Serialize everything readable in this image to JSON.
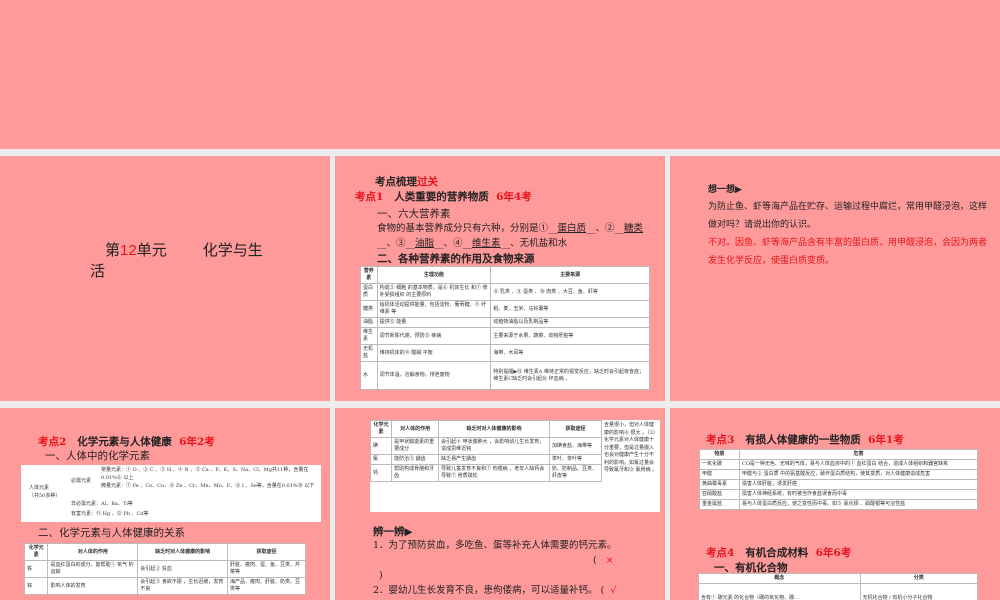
{
  "slide1": {
    "prefix": "第",
    "num": "12",
    "unit": "单元",
    "title1": "化学与生",
    "title2": "活"
  },
  "slide2": {
    "header_a": "考点梳理",
    "header_b": "过关",
    "point_label": "考点1",
    "point_title": "人类重要的营养物质",
    "point_freq": "6年4考",
    "sec1": "一、六大营养素",
    "para_a": "食物的基本营养成分只有六种，分别是①",
    "a1": "蛋白质",
    "a2": "糖类",
    "a3": "油脂",
    "a4": "维生素",
    "para_end": "、无机盐和水",
    "sec2": "二、各种营养素的作用及食物来源",
    "table": {
      "headers": [
        "营养素",
        "生理功能",
        "主要来源"
      ],
      "rows": [
        [
          "蛋白质",
          "构成⑤ 细胞 的基本物质，是⑥ 机体生长 和⑦ 修补受损组织 的主要原料",
          "⑧ 乳类 、⑨ 蛋类 、⑩ 肉类 、大豆、鱼、虾等"
        ],
        [
          "糖类",
          "给机体活动提供能量，包括淀粉、葡萄糖、⑪ 纤维素 等",
          "稻、麦、玉米、马铃薯等"
        ],
        [
          "油脂",
          "提供⑫ 能量",
          "动植物油脂以及乳制品等"
        ],
        [
          "维生素",
          "调节新陈代谢，预防⑬ 疾病",
          "主要来源于水果、蔬菜、动物肝脏等"
        ],
        [
          "无机盐",
          "维持机体的⑭ 酸碱 平衡",
          "海带、木耳等"
        ],
        [
          "水",
          "调节体温，溶解食物，排泄废物",
          "特别提醒▶⑮ 维生素A 维持正常的视觉反应，缺乏时会引起夜盲症；维生素C缺乏时会引起⑯ 坏血病 。"
        ]
      ]
    }
  },
  "slide3": {
    "title": "想一想▶",
    "question": "为防止鱼、虾等海产品在贮存、运输过程中腐烂，常用甲醛浸泡，这样做对吗？请说出你的认识。",
    "answer": "不对。因鱼、虾等海产品含有丰富的蛋白质，用甲醛浸泡，会因为两者发生化学反应，使蛋白质变质。"
  },
  "slide4": {
    "point_label": "考点2",
    "point_title": "化学元素与人体健康",
    "point_freq": "6年2考",
    "sec1": "一、人体中的化学元素",
    "root": "人体元素",
    "root_sub": "（共50多种）",
    "essential": "必需元素",
    "major": "常量元素：① O 、② C 、③ H 、④ N 、⑤ Ca 、P、K、S、Na、Cl、Mg共11种，含量在0.01%⑥ 以上",
    "trace": "微量元素：⑦ Fe 、Co、Cu、⑧ Zn 、Cr、Mn、Mo、F、⑨ I 、Se等，含量在0.01%⑩ 以下",
    "nonessential": "非必需元素：Al、Ba、Ti等",
    "harmful": "有害元素：⑪ Hg 、⑫ Pb 、Cd等",
    "sec2": "二、化学元素与人体健康的关系",
    "table": {
      "headers": [
        "化学元素",
        "对人体的作用",
        "缺乏时对人体健康的影响",
        "获取途径"
      ],
      "rows": [
        [
          "铁",
          "是血红蛋白的成分，能帮助① 氧气 的运输",
          "会引起② 贫血",
          "肝脏、瘦肉、蛋、鱼、豆类、芹菜等"
        ],
        [
          "锌",
          "影响人体的发育",
          "会引起③ 食欲不振 ，生长迟缓，发育不良",
          "海产品、瘦肉、肝脏、奶类、豆类等"
        ]
      ]
    }
  },
  "slide5": {
    "table": {
      "headers": [
        "化学元素",
        "对人体的作用",
        "缺乏时对人体健康的影响",
        "获取途径"
      ],
      "rows": [
        [
          "碘",
          "是甲状腺激素的重要成分",
          "会引起④ 甲状腺肿大 ，会影响幼儿生长发育，造成思维迟钝",
          "加碘食盐、海带等"
        ],
        [
          "氟",
          "能防治⑤ 龋齿",
          "缺乏易产生龋齿",
          "茶叶、茶叶等"
        ],
        [
          "钙",
          "帮助构成骨骼和牙齿",
          "导致儿童发育不良和⑦ 佝偻病 ，老年人缺钙会导致⑦ 骨质疏松",
          "奶、奶制品、豆类、虾皮等"
        ]
      ],
      "note": "含量很小，但对人体健康的影响⑧ 很大 。（3）化学元素对人体健康十分重要，但是过量摄入也会对健康产生十分不利的影响。如氟过量会导致氟牙和⑨ 氟骨病 。"
    },
    "quiz_title": "辨一辨▶",
    "q1": "1．为了预防贫血，多吃鱼、蛋等补充人体需要的钙元素。",
    "q1_ans": "×",
    "q2": "2．婴幼儿生长发育不良，患佝偻病，可以适量补钙。",
    "q2_ans": "√"
  },
  "slide6": {
    "point3_label": "考点3",
    "point3_title": "有损人体健康的一些物质",
    "point3_freq": "6年1考",
    "table": {
      "headers": [
        "物质",
        "危害"
      ],
      "rows": [
        [
          "一氧化碳",
          "CO是一种无色、无味的气体，易与人体血液中的① 血红蛋白 结合，造成人体组织和器官缺氧"
        ],
        [
          "甲醛",
          "甲醛与② 蛋白质 中的氨基酸反应，破坏蛋白质结构，使其变质，对人体健康造成危害"
        ],
        [
          "黄曲霉毒素",
          "损害人体肝脏，诱发肝癌"
        ],
        [
          "亚硝酸盐",
          "损害人体神经系统，有时被当作食盐误食而中毒"
        ],
        [
          "重金属盐",
          "易与人体蛋白质反应，使之变性而中毒。如③ 氯化钡 、硝酸银等可溶性盐"
        ]
      ]
    },
    "point4_label": "考点4",
    "point4_title": "有机合成材料",
    "point4_freq": "6年6考",
    "sec1": "一、有机化合物",
    "table2": {
      "headers": [
        "概念",
        "分类"
      ],
      "row": [
        "含有① 碳元素 的化合物（碳的氧化物、碳...",
        "无机化合物 / 有机小分子化合物"
      ]
    }
  },
  "colors": {
    "slide_bg": "#ff9a9a",
    "accent_red": "#e8141c",
    "answer_blue": "#1a9ad6",
    "gap": "#ececec"
  }
}
